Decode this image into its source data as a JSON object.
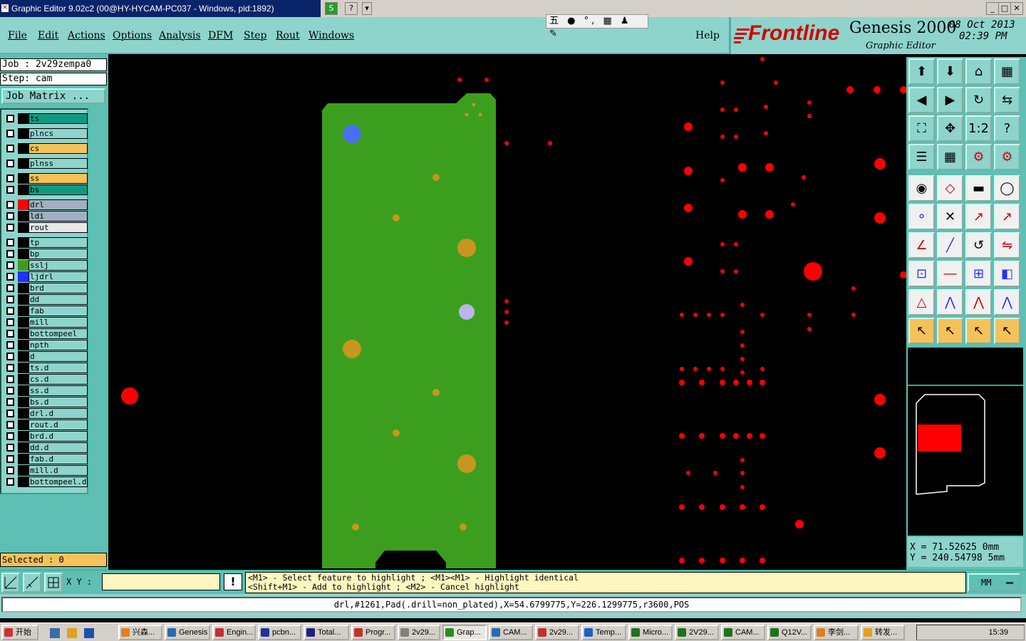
{
  "window": {
    "title": "Graphic Editor 9.02c2 (00@HY-HYCAM-PC037 - Windows, pid:1892)",
    "ime_label": "五 ● °, ▦ ♟ ✎"
  },
  "menu": {
    "file": "File",
    "edit": "Edit",
    "actions": "Actions",
    "options": "Options",
    "analysis": "Analysis",
    "dfm": "DFM",
    "step": "Step",
    "rout": "Rout",
    "windows": "Windows",
    "help": "Help"
  },
  "brand": {
    "logo": "Frontline",
    "product": "Genesis 2000",
    "subtitle": "Graphic Editor",
    "date": "08 Oct 2013",
    "time": "02:39 PM"
  },
  "job": {
    "job_line": "Job : 2v29zempa0",
    "step_line": "Step: cam",
    "matrix_button": "Job Matrix ..."
  },
  "layers": [
    {
      "name": "ts",
      "color": "#0f9b82",
      "swatch": "#000000"
    },
    {
      "name": "plncs",
      "color": "#8ed4cc",
      "swatch": "#000000"
    },
    {
      "name": "cs",
      "color": "#f5c25a",
      "swatch": "#000000"
    },
    {
      "name": "plnss",
      "color": "#8ed4cc",
      "swatch": "#000000"
    },
    {
      "name": "ss",
      "color": "#f5c25a",
      "swatch": "#000000"
    },
    {
      "name": "bs",
      "color": "#0f9b82",
      "swatch": "#000000"
    },
    {
      "name": "drl",
      "color": "#a0b0c0",
      "swatch": "#ff0000"
    },
    {
      "name": "ldi",
      "color": "#a0b0c0",
      "swatch": "#000000"
    },
    {
      "name": "rout",
      "color": "#e8e8e8",
      "swatch": "#000000"
    },
    {
      "name": "tp",
      "color": "#8ed4cc",
      "swatch": "#000000"
    },
    {
      "name": "bp",
      "color": "#8ed4cc",
      "swatch": "#000000"
    },
    {
      "name": "sslj",
      "color": "#8ed4cc",
      "swatch": "#3c9e1e"
    },
    {
      "name": "ljdrl",
      "color": "#8ed4cc",
      "swatch": "#1e32ff"
    },
    {
      "name": "brd",
      "color": "#8ed4cc",
      "swatch": "#000000"
    },
    {
      "name": "dd",
      "color": "#8ed4cc",
      "swatch": "#000000"
    },
    {
      "name": "fab",
      "color": "#8ed4cc",
      "swatch": "#000000"
    },
    {
      "name": "mill",
      "color": "#8ed4cc",
      "swatch": "#000000"
    },
    {
      "name": "bottompeel",
      "color": "#8ed4cc",
      "swatch": "#000000"
    },
    {
      "name": "npth",
      "color": "#8ed4cc",
      "swatch": "#000000"
    },
    {
      "name": "d",
      "color": "#8ed4cc",
      "swatch": "#000000"
    },
    {
      "name": "ts.d",
      "color": "#8ed4cc",
      "swatch": "#000000"
    },
    {
      "name": "cs.d",
      "color": "#8ed4cc",
      "swatch": "#000000"
    },
    {
      "name": "ss.d",
      "color": "#8ed4cc",
      "swatch": "#000000"
    },
    {
      "name": "bs.d",
      "color": "#8ed4cc",
      "swatch": "#000000"
    },
    {
      "name": "drl.d",
      "color": "#8ed4cc",
      "swatch": "#000000"
    },
    {
      "name": "rout.d",
      "color": "#8ed4cc",
      "swatch": "#000000"
    },
    {
      "name": "brd.d",
      "color": "#8ed4cc",
      "swatch": "#000000"
    },
    {
      "name": "dd.d",
      "color": "#8ed4cc",
      "swatch": "#000000"
    },
    {
      "name": "fab.d",
      "color": "#8ed4cc",
      "swatch": "#000000"
    },
    {
      "name": "mill.d",
      "color": "#8ed4cc",
      "swatch": "#000000"
    },
    {
      "name": "bottompeel.d",
      "color": "#8ed4cc",
      "swatch": "#000000"
    }
  ],
  "selected": "Selected : 0",
  "coords": {
    "x": "X  =  71.52625 0mm",
    "y": "Y  =  240.54798 5mm"
  },
  "command": {
    "xy_label": "X Y :",
    "xy_value": "",
    "hint_line1": "<M1> - Select feature to highlight ; <M1><M1> - Highlight identical",
    "hint_line2": "<Shift+M1> - Add to highlight ; <M2> - Cancel highlight",
    "units": "MM"
  },
  "status": "drl,#1261,Pad(.drill=non_plated),X=54.6799775,Y=226.1299775,r3600,POS",
  "taskbar": {
    "start": "开始",
    "clock": "15:39",
    "items": [
      "兴森...",
      "Genesis",
      "Engin...",
      "pcbn...",
      "Total...",
      "Progr...",
      "2v29...",
      "Grap...",
      "CAM...",
      "2v29...",
      "Temp...",
      "Micro...",
      "2V29...",
      "CAM...",
      "Q12V...",
      "李剑...",
      "转发..."
    ]
  }
}
